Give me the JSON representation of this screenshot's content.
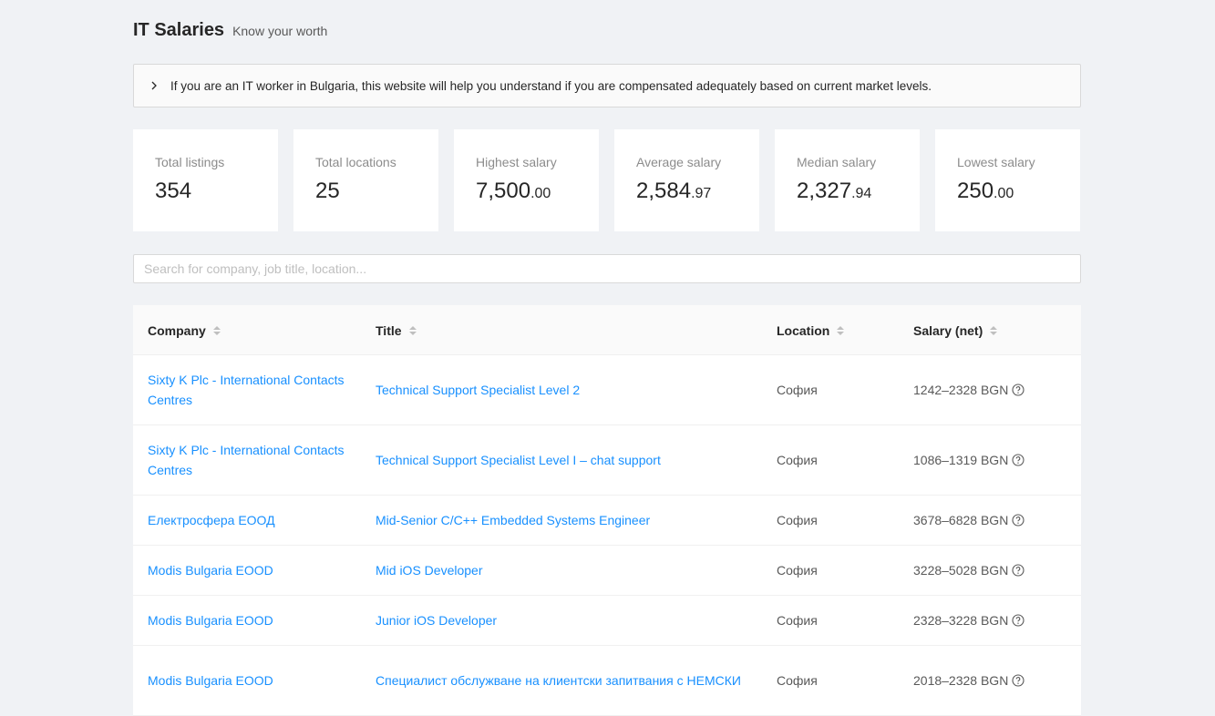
{
  "header": {
    "title": "IT Salaries",
    "subtitle": "Know your worth"
  },
  "notice": {
    "text": "If you are an IT worker in Bulgaria, this website will help you understand if you are compensated adequately based on current market levels.",
    "icon": "chevron-right-icon"
  },
  "stats": [
    {
      "label": "Total listings",
      "int": "354",
      "dec": ""
    },
    {
      "label": "Total locations",
      "int": "25",
      "dec": ""
    },
    {
      "label": "Highest salary",
      "int": "7,500",
      "dec": ".00"
    },
    {
      "label": "Average salary",
      "int": "2,584",
      "dec": ".97"
    },
    {
      "label": "Median salary",
      "int": "2,327",
      "dec": ".94"
    },
    {
      "label": "Lowest salary",
      "int": "250",
      "dec": ".00"
    }
  ],
  "search": {
    "placeholder": "Search for company, job title, location...",
    "value": ""
  },
  "table": {
    "columns": [
      "Company",
      "Title",
      "Location",
      "Salary (net)"
    ],
    "rows": [
      {
        "company": "Sixty K Plc - International Contacts Centres",
        "title": "Technical Support Specialist Level 2",
        "location": "София",
        "salary": "1242–2328 BGN"
      },
      {
        "company": "Sixty K Plc - International Contacts Centres",
        "title": "Technical Support Specialist Level I – chat support",
        "location": "София",
        "salary": "1086–1319 BGN"
      },
      {
        "company": "Електросфера ЕООД",
        "title": "Mid-Senior C/C++ Embedded Systems Engineer",
        "location": "София",
        "salary": "3678–6828 BGN"
      },
      {
        "company": "Modis Bulgaria EOOD",
        "title": "Mid iOS Developer",
        "location": "София",
        "salary": "3228–5028 BGN"
      },
      {
        "company": "Modis Bulgaria EOOD",
        "title": "Junior iOS Developer",
        "location": "София",
        "salary": "2328–3228 BGN"
      },
      {
        "company": "Modis Bulgaria EOOD",
        "title": "Специалист обслужване на клиентски запитвания с НЕМСКИ",
        "location": "София",
        "salary": "2018–2328 BGN"
      }
    ]
  },
  "colors": {
    "link": "#1890ff",
    "background": "#f0f2f5"
  }
}
